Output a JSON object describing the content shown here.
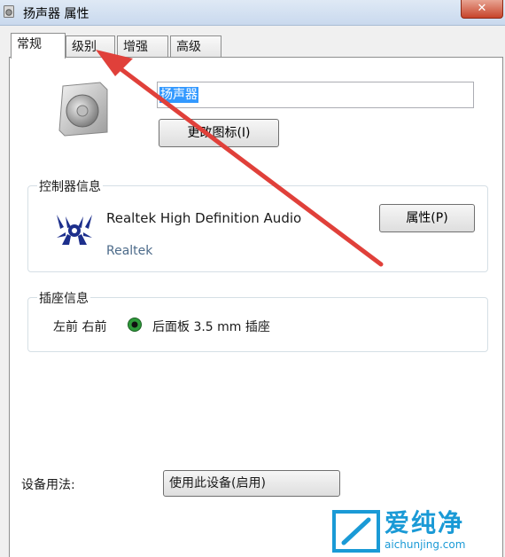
{
  "window": {
    "title": "扬声器 属性",
    "close_label": "✕"
  },
  "tabs": [
    {
      "label": "常规",
      "active": true
    },
    {
      "label": "级别",
      "active": false
    },
    {
      "label": "增强",
      "active": false
    },
    {
      "label": "高级",
      "active": false
    }
  ],
  "general": {
    "device_icon": "speaker-icon",
    "device_name_value": "扬声器",
    "change_icon_button": "更改图标(I)"
  },
  "controller": {
    "group_label": "控制器信息",
    "logo": "realtek-logo",
    "device_name": "Realtek High Definition Audio",
    "vendor": "Realtek",
    "properties_button": "属性(P)"
  },
  "jack": {
    "group_label": "插座信息",
    "channels": "左前 右前",
    "jack_color": "#2e9b3a",
    "jack_description": "后面板 3.5 mm 插座"
  },
  "usage": {
    "label": "设备用法:",
    "selected": "使用此设备(启用)"
  },
  "annotation": {
    "arrow_color": "#e0403a"
  },
  "watermark": {
    "brand": "爱纯净",
    "url": "aichunjing.com"
  }
}
